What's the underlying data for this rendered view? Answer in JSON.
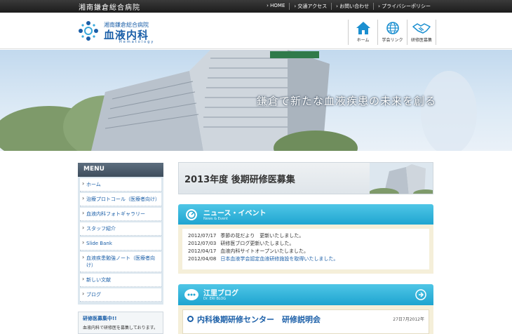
{
  "site": {
    "name": "湘南鎌倉総合病院"
  },
  "topnav": {
    "items": [
      "› HOME",
      "› 交通アクセス",
      "› お問い合わせ",
      "› プライバシーポリシー"
    ]
  },
  "logo": {
    "sub": "湘南鎌倉総合病院",
    "main": "血液内科",
    "en": "Hematology"
  },
  "header_icons": [
    {
      "label": "ホーム",
      "icon": "home-icon"
    },
    {
      "label": "学会リンク",
      "icon": "globe-icon"
    },
    {
      "label": "研修医募集",
      "icon": "handshake-icon"
    }
  ],
  "hero": {
    "tagline": "鎌倉で新たな血液疾患の未来を創る"
  },
  "menu": {
    "title": "MENU",
    "items": [
      "ホーム",
      "治療プロトコール（医療者向け）",
      "血液内科フォトギャラリー",
      "スタッフ紹介",
      "Slide Bank",
      "血液疾患勉強ノート（医療者向け）",
      "新しい文献",
      "ブログ"
    ]
  },
  "recruit": {
    "title": "研修医募集中!!",
    "desc": "血液内科で研修医を募集しております。"
  },
  "banner": {
    "text": "2013年度 後期研修医募集"
  },
  "news": {
    "title": "ニュース・イベント",
    "subtitle": "News & Event",
    "rows": [
      {
        "date": "2012/07/17",
        "text": "季節の花だより　更新いたしました。",
        "link": false
      },
      {
        "date": "2012/07/03",
        "text": "研修医ブログ更新いたしました。",
        "link": false
      },
      {
        "date": "2012/04/17",
        "text": "血液内科サイトオープンいたしました。",
        "link": false
      },
      {
        "date": "2012/04/08",
        "text": "日本血液学会認定血液研修施設を取得いたしました。",
        "link": true
      }
    ]
  },
  "blog": {
    "title": "江里ブログ",
    "subtitle": "Dr. ERI BLOG",
    "post_title": "内科後期研修センター　研修説明会",
    "post_date": "27日7月2012年"
  },
  "colors": {
    "brand": "#1b5fa8",
    "accent": "#1ea4d0",
    "topbar": "#2a2a2a"
  }
}
